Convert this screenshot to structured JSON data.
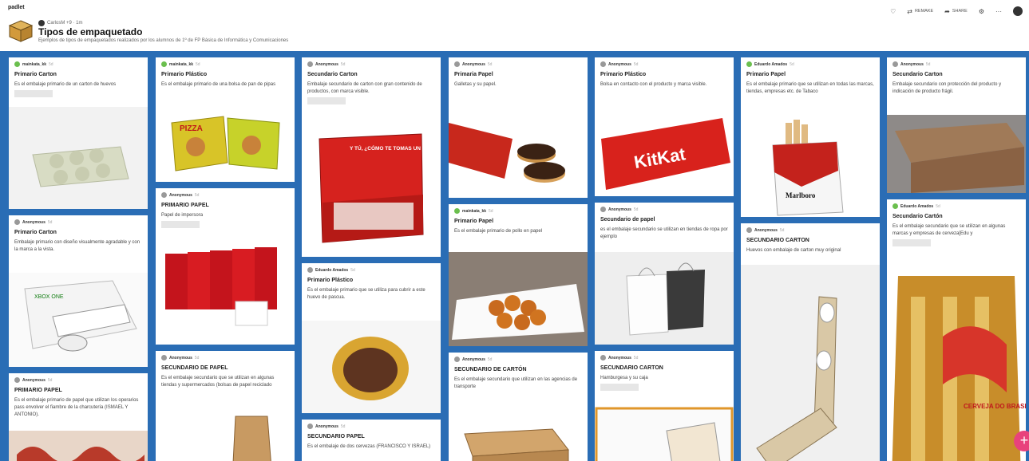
{
  "app": {
    "brand": "padlet"
  },
  "board": {
    "author": "CarlosM +9 · 1m",
    "title": "Tipos de empaquetado",
    "description": "Ejemplos de tipos de empaquetados realizados por los alumnos de 1º de FP Básica de Informática y Comunicaciones"
  },
  "actions": {
    "remake": "REMAKE",
    "share": "SHARE"
  },
  "posts": [
    {
      "author": "mainkata_kk",
      "ago": "5d",
      "title": "Primario Carton",
      "body": "Es el embalaje primario de un carton de huevos"
    },
    {
      "author": "Anonymous",
      "ago": "5d",
      "title": "Primario Carton",
      "body": "Embalaje primario con diseño visualmente agradable y con la marca a la vista."
    },
    {
      "author": "Anonymous",
      "ago": "5d",
      "title": "PRIMARIO PAPEL",
      "body": "Es el embalaje primario de papel que utilizan los operarios pass envolver el fiambre de la charcutería (ISMAEL Y ANTONIO)."
    },
    {
      "author": "mainkata_kk",
      "ago": "5d",
      "title": "Primario Plástico",
      "body": "Es el embalaje primario de una bolsa de pan de pipas"
    },
    {
      "author": "Anonymous",
      "ago": "5d",
      "title": "PRIMARIO PAPEL",
      "body": "Papel de impersora"
    },
    {
      "author": "Anonymous",
      "ago": "5d",
      "title": "SECUNDARIO DE PAPEL",
      "body": "Es el embalaje secundario que se utilizan en algunas tiendas y supermercados (bolsas de papel reciclado"
    },
    {
      "author": "Anonymous",
      "ago": "5d",
      "title": "Secundario Carton",
      "body": "Embalaje secundario de carton con gran contenido de productos, con marca visible."
    },
    {
      "author": "Eduardo Amados",
      "ago": "5d",
      "title": "Primario Plástico",
      "body": "Es el embalaje primario que se utiliza para cubrir a este huevo de pascua."
    },
    {
      "author": "Anonymous",
      "ago": "5d",
      "title": "SECUNDARIO PAPEL",
      "body": "Es el embalaje de dos cervezas (FRANCISCO Y ISRAEL)"
    },
    {
      "author": "Anonymous",
      "ago": "5d",
      "title": "Primaria Papel",
      "body": "Galletas y su papel."
    },
    {
      "author": "mainkata_kk",
      "ago": "5d",
      "title": "Primario Papel",
      "body": "Es el embalaje primario de pollo en papel"
    },
    {
      "author": "Anonymous",
      "ago": "5d",
      "title": "SECUNDARIO DE CARTÓN",
      "body": "Es el embalaje secundario que utilizan en las agencias de transporte"
    },
    {
      "author": "Anonymous",
      "ago": "5d",
      "title": "Primario Plástico",
      "body": "Bolsa en contacto con el producto y marca visible."
    },
    {
      "author": "Anonymous",
      "ago": "5d",
      "title": "Secundario de papel",
      "body": "es el embalaje secundario se utilizan en tiendas de ropa por ejemplo"
    },
    {
      "author": "Anonymous",
      "ago": "5d",
      "title": "SECUNDARIO CARTON",
      "body": "Hamburgesa y su caja"
    },
    {
      "author": "Eduardo Amados",
      "ago": "5d",
      "title": "Primario Papel",
      "body": "Es el embalaje primario que se utilizan en todas las marcas, tiendas, empresas etc. de Tabaco"
    },
    {
      "author": "Anonymous",
      "ago": "5d",
      "title": "SECUNDARIO CARTON",
      "body": "Huevos con embalaje de carton muy original"
    },
    {
      "author": "Anonymous",
      "ago": "5d",
      "title": "Secundario Carton",
      "body": "Embalaje secundario con protección del producto y indicación de producto frágil."
    },
    {
      "author": "Eduardo Amados",
      "ago": "5d",
      "title": "Secundario Cartón",
      "body": "Es el embalaje secundario que se utilizan en algunas marcas y empresas de cerveza[Edu y"
    }
  ],
  "image_text": {
    "pizza": "PIZZA",
    "kitkat": "KitKat",
    "ytu": "Y TÚ, ¿CÓMO TE TOMAS UN RESPIRO?",
    "xbox": "XBOX ONE",
    "marlboro": "Marlboro",
    "brasil": "CERVEJA DO BRASIL"
  },
  "colors": {
    "wall": "#2a6db5",
    "accent": "#e8427c"
  }
}
